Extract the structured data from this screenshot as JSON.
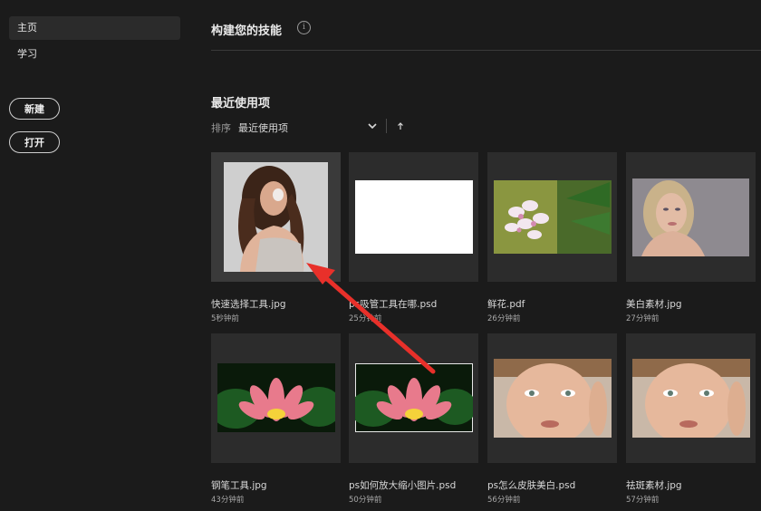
{
  "sidebar": {
    "items": [
      {
        "label": "主页",
        "active": true
      },
      {
        "label": "学习",
        "active": false
      }
    ],
    "new_button": "新建",
    "open_button": "打开"
  },
  "main": {
    "skills_title": "构建您的技能",
    "info_icon": "i",
    "recent_title": "最近使用项",
    "sort_label": "排序",
    "sort_value": "最近使用项"
  },
  "files": [
    {
      "name": "快速选择工具.jpg",
      "time": "5秒钟前",
      "thumb": "portrait-woman-curly"
    },
    {
      "name": "ps吸管工具在哪.psd",
      "time": "25分钟前",
      "thumb": "blank-white"
    },
    {
      "name": "鲜花.pdf",
      "time": "26分钟前",
      "thumb": "frangipani-flower"
    },
    {
      "name": "美白素材.jpg",
      "time": "27分钟前",
      "thumb": "portrait-woman-blonde"
    },
    {
      "name": "钢笔工具.jpg",
      "time": "43分钟前",
      "thumb": "lotus-flower"
    },
    {
      "name": "ps如何放大缩小图片.psd",
      "time": "50分钟前",
      "thumb": "lotus-flower-framed"
    },
    {
      "name": "ps怎么皮肤美白.psd",
      "time": "56分钟前",
      "thumb": "face-closeup"
    },
    {
      "name": "祛斑素材.jpg",
      "time": "57分钟前",
      "thumb": "face-closeup"
    }
  ],
  "colors": {
    "background": "#1b1b1b",
    "card": "#2c2c2c",
    "annotation_arrow": "#e8302a"
  }
}
